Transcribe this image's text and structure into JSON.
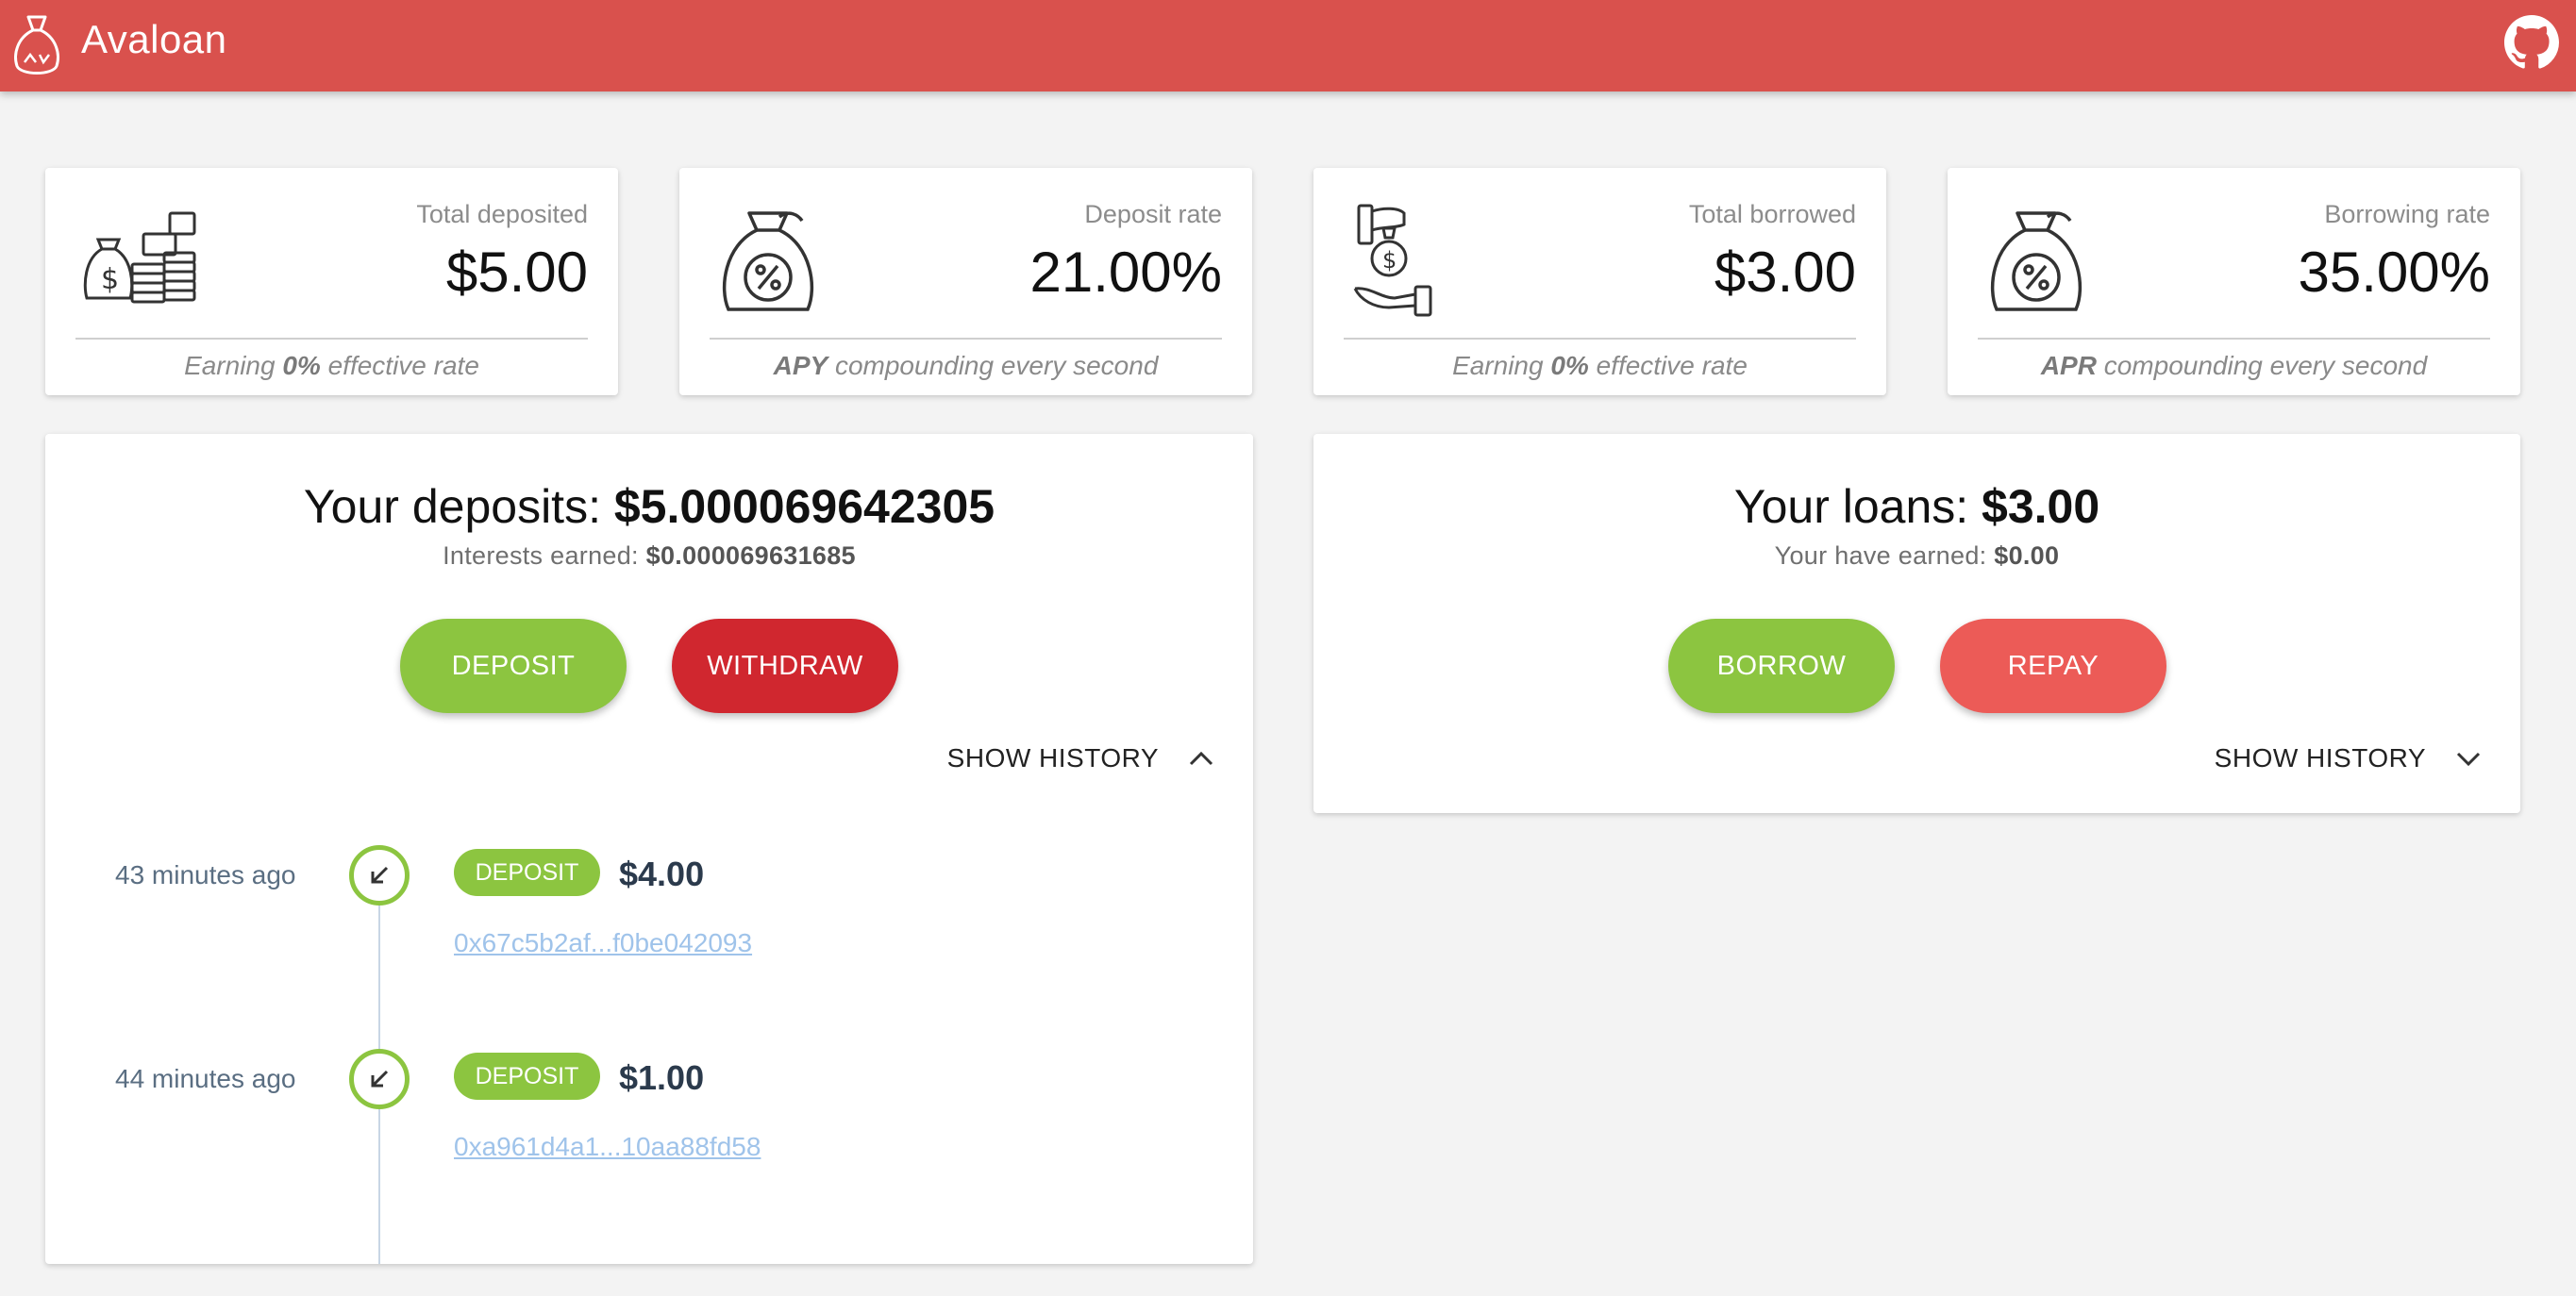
{
  "app": {
    "title": "Avaloan",
    "logo_icon": "money-bag-logo-icon",
    "github_icon": "github-icon"
  },
  "colors": {
    "header": "#d9514d",
    "green": "#8cc540",
    "red": "#d0272f",
    "salmon": "#ec5b57"
  },
  "stats": [
    {
      "label": "Total deposited",
      "value": "$5.00",
      "foot_pre": "Earning ",
      "foot_bold": "0%",
      "foot_post": " effective rate",
      "icon": "money-coins-icon"
    },
    {
      "label": "Deposit rate",
      "value": "21.00%",
      "foot_pre": "",
      "foot_bold": "APY",
      "foot_post": " compounding every second",
      "icon": "percent-bag-icon"
    },
    {
      "label": "Total borrowed",
      "value": "$3.00",
      "foot_pre": "Earning ",
      "foot_bold": "0%",
      "foot_post": " effective rate",
      "icon": "hand-money-icon"
    },
    {
      "label": "Borrowing rate",
      "value": "35.00%",
      "foot_pre": "",
      "foot_bold": "APR",
      "foot_post": " compounding every second",
      "icon": "percent-bag-icon"
    }
  ],
  "deposits": {
    "title_pre": "Your deposits: ",
    "title_value": "$5.000069642305",
    "sub_pre": "Interests earned: ",
    "sub_value": "$0.000069631685",
    "primary_button": "Deposit",
    "secondary_button": "Withdraw",
    "history_toggle": "SHOW HISTORY",
    "history_expanded": true,
    "history": [
      {
        "time": "43 minutes ago",
        "type": "Deposit",
        "amount": "$4.00",
        "hash": "0x67c5b2af...f0be042093"
      },
      {
        "time": "44 minutes ago",
        "type": "Deposit",
        "amount": "$1.00",
        "hash": "0xa961d4a1...10aa88fd58"
      }
    ]
  },
  "loans": {
    "title_pre": "Your loans: ",
    "title_value": "$3.00",
    "sub_pre": "Your have earned: ",
    "sub_value": "$0.00",
    "primary_button": "Borrow",
    "secondary_button": "Repay",
    "history_toggle": "SHOW HISTORY",
    "history_expanded": false
  }
}
